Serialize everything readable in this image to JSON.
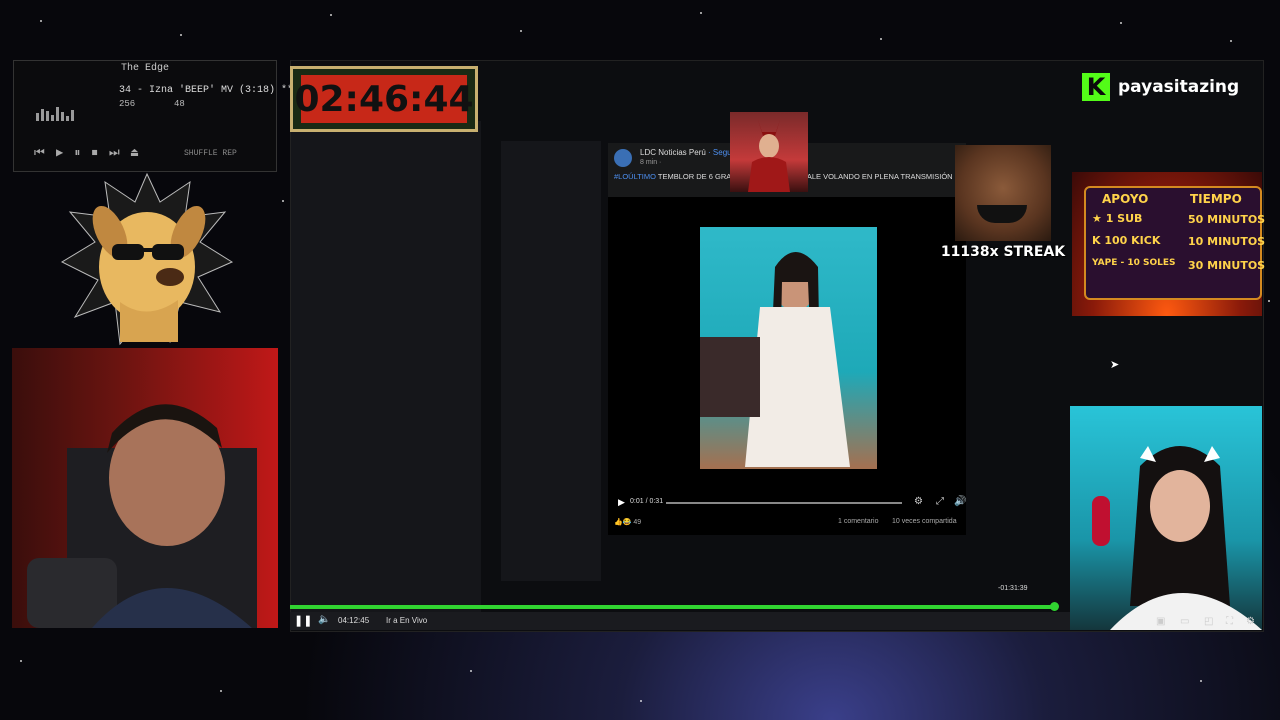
{
  "winamp": {
    "title": "The Edge",
    "track": "34 - Izna 'BEEP' MV (3:18)  *** 3",
    "kbps": "256",
    "khz": "48",
    "controls": "⏮ ▶ ⏸ ⏹ ⏭ ⏏",
    "mode": "SHUFFLE  REP"
  },
  "timer": {
    "value": "02:46:44"
  },
  "post": {
    "page_name": "LDC Noticias Perú",
    "follow": "· Seguir",
    "time": "8 min · ",
    "hashtag": "#LOÚLTIMO",
    "text": " TEMBLOR DE 6 GRA... TE Y TIKTOKERA SALE VOLANDO EN PLENA TRANSMISIÓN",
    "video_time": "0:01 / 0:31",
    "reactions_count": "49",
    "comments": "1 comentario",
    "shares": "10 veces compartida"
  },
  "scarlet": {
    "caption": ""
  },
  "streak": {
    "text": "11138x STREAK"
  },
  "kick": {
    "logo_letter": "K",
    "channel": "payasitazing"
  },
  "support": {
    "header_left": "APOYO",
    "header_right": "TIEMPO",
    "rows": [
      {
        "label": "★ 1 SUB",
        "value": "50 MINUTOS"
      },
      {
        "label": "K 100 KICK",
        "value": "10 MINUTOS"
      },
      {
        "label": "YAPE - 10 SOLES",
        "value": "30 MINUTOS"
      }
    ]
  },
  "player": {
    "elapsed": "04:12:45",
    "live_label": "Ir a En Vivo",
    "remaining": "-01:31:39",
    "progress_fraction": 0.99
  },
  "colors": {
    "kick_green": "#53fc18",
    "progress_green": "#31d431",
    "timer_red": "#c72818"
  },
  "icons": [
    "pause-icon",
    "volume-icon",
    "settings-icon",
    "fullscreen-icon",
    "play-icon",
    "cursor-icon"
  ]
}
